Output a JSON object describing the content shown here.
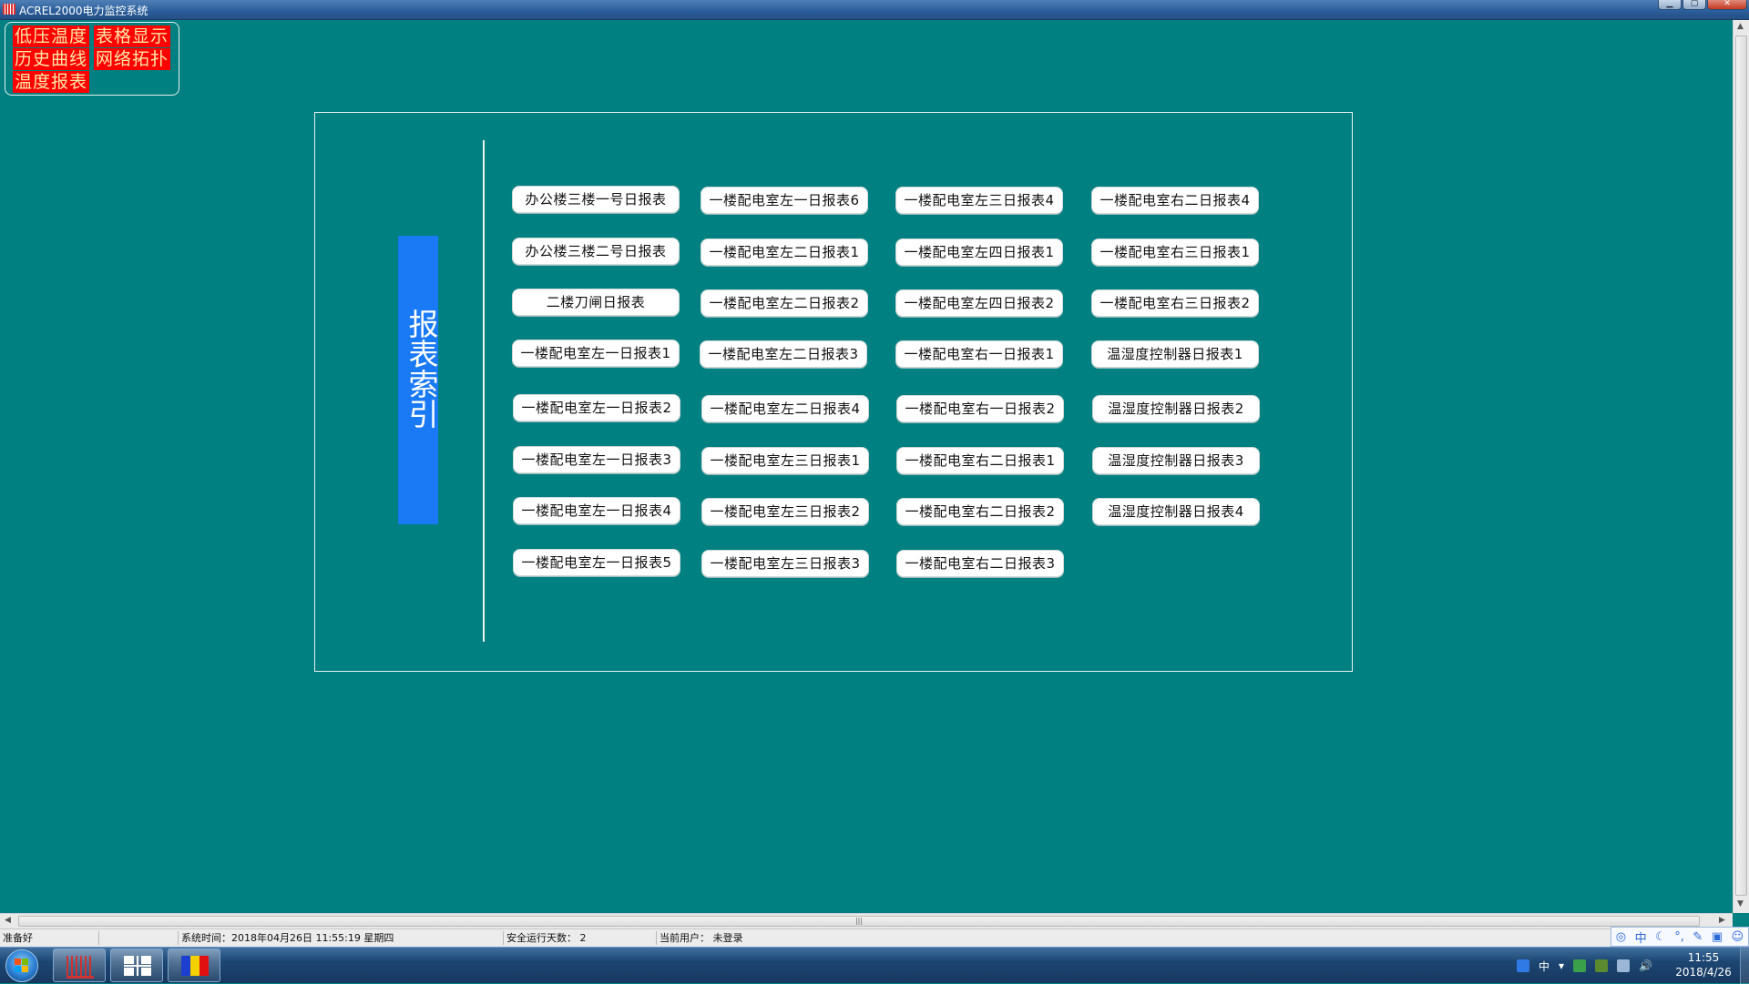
{
  "window": {
    "title": "ACREL2000电力监控系统"
  },
  "quick_nav": {
    "items": [
      "低压温度",
      "表格显示",
      "历史曲线",
      "网络拓扑",
      "温度报表"
    ]
  },
  "index_panel": {
    "label": "报表索引",
    "reports": [
      "办公楼三楼一号日报表",
      "一楼配电室左一日报表6",
      "一楼配电室左三日报表4",
      "一楼配电室右二日报表4",
      "办公楼三楼二号日报表",
      "一楼配电室左二日报表1",
      "一楼配电室左四日报表1",
      "一楼配电室右三日报表1",
      "二楼刀闸日报表",
      "一楼配电室左二日报表2",
      "一楼配电室左四日报表2",
      "一楼配电室右三日报表2",
      "一楼配电室左一日报表1",
      "一楼配电室左二日报表3",
      "一楼配电室右一日报表1",
      "温湿度控制器日报表1",
      "一楼配电室左一日报表2",
      "一楼配电室左二日报表4",
      "一楼配电室右一日报表2",
      "温湿度控制器日报表2",
      "一楼配电室左一日报表3",
      "一楼配电室左三日报表1",
      "一楼配电室右二日报表1",
      "温湿度控制器日报表3",
      "一楼配电室左一日报表4",
      "一楼配电室左三日报表2",
      "一楼配电室右二日报表2",
      "温湿度控制器日报表4",
      "一楼配电室左一日报表5",
      "一楼配电室左三日报表3",
      "一楼配电室右二日报表3"
    ]
  },
  "status_bar": {
    "ready": "准备好",
    "system_time": "系统时间：2018年04月26日  11:55:19  星期四",
    "safe_days": "安全运行天数：  2",
    "current_user": "当前用户：  未登录"
  },
  "ime": {
    "mode": "中"
  },
  "taskbar": {
    "apps": [
      "power-monitor-app",
      "network-app",
      "flag-app"
    ],
    "tray_lang": "中",
    "clock_time": "11:55",
    "clock_date": "2018/4/26"
  },
  "colors": {
    "background": "#008080",
    "index_tag": "#1a7af5",
    "nav_button": "#ff0000",
    "nav_text": "#ffe9a8"
  }
}
